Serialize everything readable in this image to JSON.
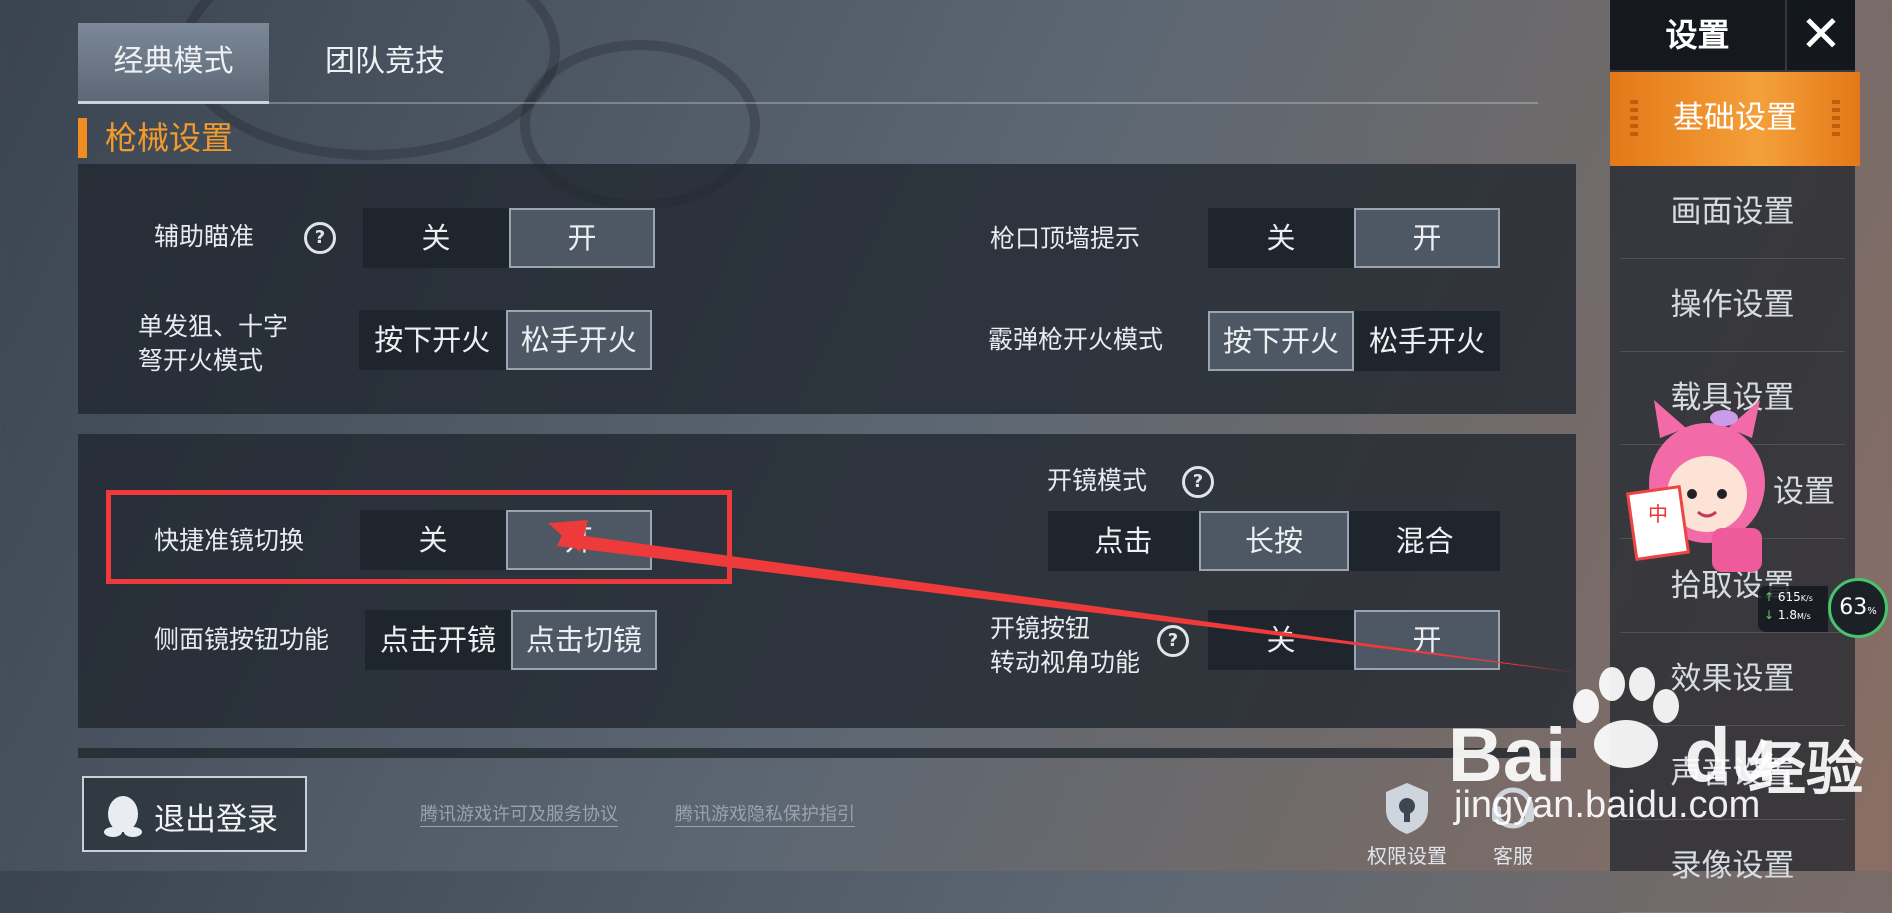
{
  "tabs": [
    {
      "label": "经典模式",
      "active": true
    },
    {
      "label": "团队竞技",
      "active": false
    }
  ],
  "section_title": "枪械设置",
  "settings": {
    "aim_assist": {
      "label": "辅助瞄准",
      "options": [
        "关",
        "开"
      ],
      "selected": 1
    },
    "muzzle_wall": {
      "label": "枪口顶墙提示",
      "options": [
        "关",
        "开"
      ],
      "selected": 1
    },
    "single_fire": {
      "label_line1": "单发狙、十字",
      "label_line2": "弩开火模式",
      "options": [
        "按下开火",
        "松手开火"
      ],
      "selected": 1
    },
    "shotgun_fire": {
      "label": "霰弹枪开火模式",
      "options": [
        "按下开火",
        "松手开火"
      ],
      "selected": 0
    },
    "scope_mode": {
      "label": "开镜模式",
      "options": [
        "点击",
        "长按",
        "混合"
      ],
      "selected": 1
    },
    "quick_scope": {
      "label": "快捷准镜切换",
      "options": [
        "关",
        "开"
      ],
      "selected": 1
    },
    "side_scope": {
      "label": "侧面镜按钮功能",
      "options": [
        "点击开镜",
        "点击切镜"
      ],
      "selected": 1
    },
    "scope_button_turn": {
      "label_line1": "开镜按钮",
      "label_line2": "转动视角功能",
      "options": [
        "关",
        "开"
      ],
      "selected": 1
    }
  },
  "sidebar": {
    "title": "设置",
    "close_icon": "close-icon",
    "items": [
      {
        "label": "基础设置",
        "active": true
      },
      {
        "label": "画面设置"
      },
      {
        "label": "操作设置"
      },
      {
        "label": "载具设置"
      },
      {
        "label": "设置"
      },
      {
        "label": "拾取设置"
      },
      {
        "label": "效果设置"
      },
      {
        "label": "声音设置"
      },
      {
        "label": "录像设置"
      }
    ]
  },
  "footer": {
    "logout": "退出登录",
    "link_license": "腾讯游戏许可及服务协议",
    "link_privacy": "腾讯游戏隐私保护指引",
    "permission": "权限设置",
    "support": "客服"
  },
  "network": {
    "up": "615",
    "up_unit": "K/s",
    "down": "1.8",
    "down_unit": "M/s",
    "percent": "63",
    "percent_unit": "%"
  },
  "sticker": {
    "sign_text": "中"
  },
  "watermark": {
    "brand_part1": "Bai",
    "brand_part2": "du",
    "brand_cn": "经验",
    "url": "jingyan.baidu.com"
  },
  "colors": {
    "accent": "#f18e22",
    "highlight": "#ee3a3a"
  }
}
